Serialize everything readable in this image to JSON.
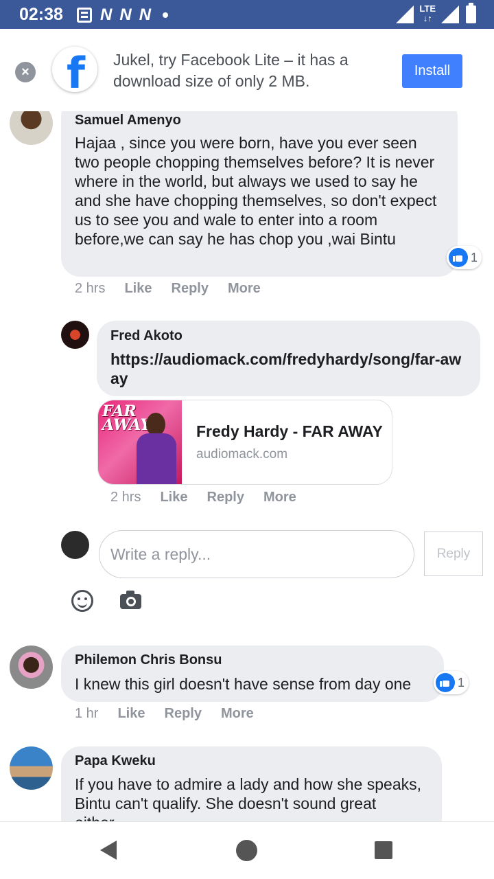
{
  "status_bar": {
    "time": "02:38",
    "notification_letters": [
      "N",
      "N",
      "N"
    ],
    "network": "LTE"
  },
  "promo": {
    "text": "Jukel, try Facebook Lite – it has a download size of only 2 MB.",
    "install_label": "Install",
    "logo_letter": "f",
    "close_glyph": "×"
  },
  "comments": [
    {
      "author": "Samuel Amenyo",
      "text": "Hajaa , since you were born, have you ever seen two people chopping themselves before? It is never where in the world, but always we used to say he and she have chopping themselves, so don't expect us to see you and wale to enter into a room before,we can say he has chop you ,wai Bintu",
      "time": "2 hrs",
      "like_label": "Like",
      "reply_label": "Reply",
      "more_label": "More",
      "reaction_count": "1"
    },
    {
      "author": "Fred Akoto",
      "text": "https://audiomack.com/fredyhardy/song/far-away",
      "time": "2 hrs",
      "like_label": "Like",
      "reply_label": "Reply",
      "more_label": "More",
      "link_title": "Fredy Hardy - FAR AWAY",
      "link_domain": "audiomack.com",
      "thumb_text": "FAR AWAY"
    },
    {
      "author": "Philemon Chris Bonsu",
      "text": "I knew this girl doesn't have sense from day one",
      "time": "1 hr",
      "like_label": "Like",
      "reply_label": "Reply",
      "more_label": "More",
      "reaction_count": "1"
    },
    {
      "author": "Papa Kweku",
      "text": "If you have to admire a lady and how she speaks, Bintu can't qualify. She doesn't sound great either..."
    }
  ],
  "reply_box": {
    "placeholder": "Write a reply...",
    "button_label": "Reply"
  },
  "icons": {
    "emoji": "smile-icon",
    "camera": "camera-icon",
    "like": "like-icon"
  },
  "colors": {
    "status_bar": "#3b5998",
    "install": "#4080ff",
    "bubble": "#ebedf0",
    "like_blue": "#1877f2"
  }
}
